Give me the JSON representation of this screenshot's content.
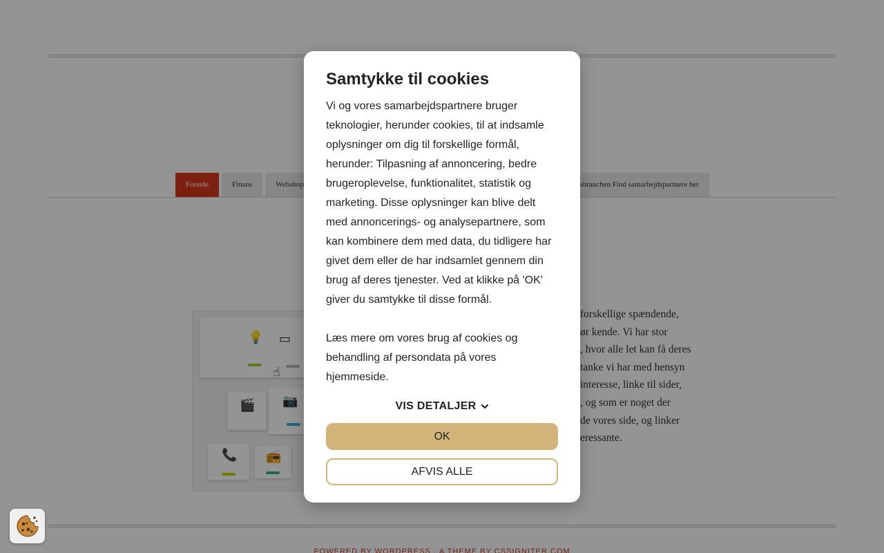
{
  "nav": {
    "items": [
      {
        "label": "Forside",
        "active": true
      },
      {
        "label": "Finans",
        "active": false
      },
      {
        "label": "Webshop",
        "active": false
      }
    ],
    "right_item_label": "sbranchen Find samarbejdspartnere her"
  },
  "article": {
    "lines": [
      "forskellige spændende,",
      "ør kende. Vi har stor",
      ", hvor alle let kan få deres",
      "tanke vi har med hensyn",
      "interesse, linke til sider,",
      ", og som er noget der",
      "de vores side, og linker",
      "eressante."
    ]
  },
  "footer": {
    "credit": "POWERED BY WORDPRESS · A THEME BY CSSIGNITER.COM"
  },
  "consent": {
    "title": "Samtykke til cookies",
    "paragraph1": "Vi og vores samarbejdspartnere bruger teknologier, herunder cookies, til at indsamle oplysninger om dig til forskellige formål, herunder: Tilpasning af annoncering, bedre brugeroplevelse, funktionalitet, statistik og marketing. Disse oplysninger kan blive delt med annoncerings- og analysepartnere, som kan kombinere dem med data, du tidligere har givet dem eller de har indsamlet gennem din brug af deres tjenester. Ved at klikke på 'OK' giver du samtykke til disse formål.",
    "paragraph2": "Læs mere om vores brug af cookies og behandling af persondata på vores hjemmeside.",
    "details_label": "VIS DETALJER",
    "ok_label": "OK",
    "reject_label": "AFVIS ALLE",
    "accent_color": "#d0b47a"
  },
  "icons": {
    "cookie_settings": "cookie-icon",
    "details_toggle": "chevron-down-icon"
  }
}
